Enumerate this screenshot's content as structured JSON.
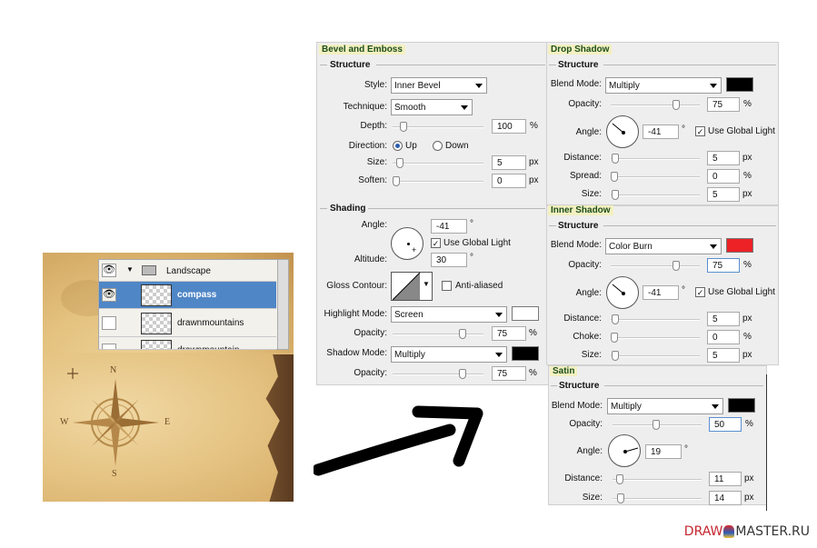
{
  "layers_panel": {
    "group_name": "Landscape",
    "layers": [
      "compass",
      "drawnmountains",
      "drawnmountain"
    ]
  },
  "compass": {
    "n": "N",
    "s": "S",
    "e": "E",
    "w": "W"
  },
  "bevel": {
    "title": "Bevel and Emboss",
    "structure": "Structure",
    "style_label": "Style:",
    "style_value": "Inner Bevel",
    "technique_label": "Technique:",
    "technique_value": "Smooth",
    "depth_label": "Depth:",
    "depth_value": "100",
    "depth_unit": "%",
    "direction_label": "Direction:",
    "dir_up": "Up",
    "dir_down": "Down",
    "size_label": "Size:",
    "size_value": "5",
    "size_unit": "px",
    "soften_label": "Soften:",
    "soften_value": "0",
    "soften_unit": "px",
    "shading": "Shading",
    "angle_label": "Angle:",
    "angle_value": "-41",
    "deg": "°",
    "global_light": "Use Global Light",
    "altitude_label": "Altitude:",
    "altitude_value": "30",
    "gloss_label": "Gloss Contour:",
    "anti_aliased": "Anti-aliased",
    "highlight_label": "Highlight Mode:",
    "highlight_value": "Screen",
    "opacity_label": "Opacity:",
    "highlight_opacity": "75",
    "pct": "%",
    "shadow_label": "Shadow Mode:",
    "shadow_value": "Multiply",
    "shadow_opacity": "75",
    "highlight_color": "#ffffff",
    "shadow_color": "#000000"
  },
  "drop_shadow": {
    "title": "Drop Shadow",
    "structure": "Structure",
    "blend_label": "Blend Mode:",
    "blend_value": "Multiply",
    "color": "#000000",
    "opacity_label": "Opacity:",
    "opacity_value": "75",
    "pct": "%",
    "angle_label": "Angle:",
    "angle_value": "-41",
    "deg": "°",
    "global_light": "Use Global Light",
    "distance_label": "Distance:",
    "distance_value": "5",
    "spread_label": "Spread:",
    "spread_value": "0",
    "size_label": "Size:",
    "size_value": "5",
    "px": "px"
  },
  "inner_shadow": {
    "title": "Inner Shadow",
    "structure": "Structure",
    "blend_label": "Blend Mode:",
    "blend_value": "Color Burn",
    "color": "#ec2227",
    "opacity_label": "Opacity:",
    "opacity_value": "75",
    "pct": "%",
    "angle_label": "Angle:",
    "angle_value": "-41",
    "deg": "°",
    "global_light": "Use Global Light",
    "distance_label": "Distance:",
    "distance_value": "5",
    "choke_label": "Choke:",
    "choke_value": "0",
    "size_label": "Size:",
    "size_value": "5",
    "px": "px"
  },
  "satin": {
    "title": "Satin",
    "structure": "Structure",
    "blend_label": "Blend Mode:",
    "blend_value": "Multiply",
    "color": "#000000",
    "opacity_label": "Opacity:",
    "opacity_value": "50",
    "pct": "%",
    "angle_label": "Angle:",
    "angle_value": "19",
    "deg": "°",
    "distance_label": "Distance:",
    "distance_value": "11",
    "size_label": "Size:",
    "size_value": "14",
    "px": "px"
  },
  "logo": {
    "left": "DRAW",
    "right": "MASTER.RU"
  }
}
